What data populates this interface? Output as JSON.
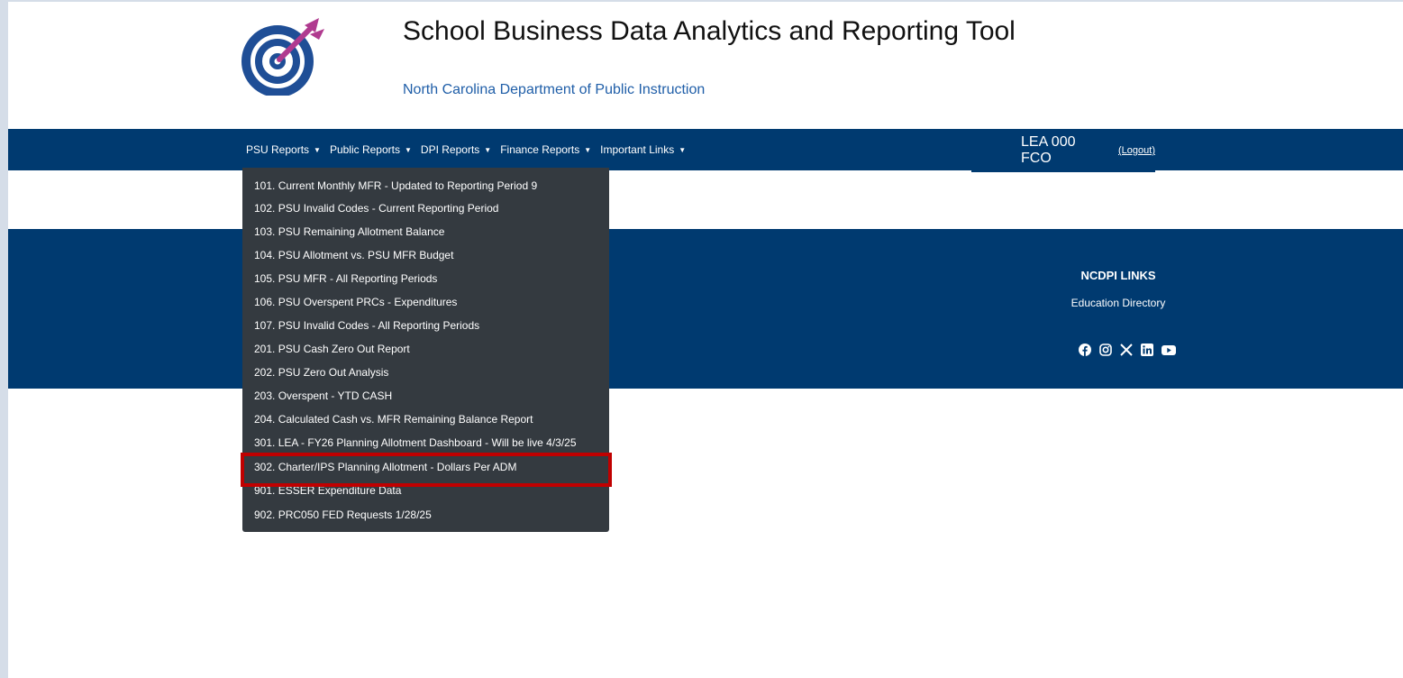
{
  "header": {
    "title": "School Business Data Analytics and Reporting Tool",
    "subtitle": "North Carolina Department of Public Instruction",
    "logo_icon": "target-dart-icon"
  },
  "nav": {
    "items": [
      {
        "label": "PSU Reports"
      },
      {
        "label": "Public Reports"
      },
      {
        "label": "DPI Reports"
      },
      {
        "label": "Finance Reports"
      },
      {
        "label": "Important Links"
      }
    ],
    "user": "LEA 000 FCO",
    "logout": "(Logout)"
  },
  "dropdown": {
    "items": [
      "101. Current Monthly MFR - Updated to Reporting Period 9",
      "102. PSU Invalid Codes - Current Reporting Period",
      "103. PSU Remaining Allotment Balance",
      "104. PSU Allotment vs. PSU MFR Budget",
      "105. PSU MFR - All Reporting Periods",
      "106. PSU Overspent PRCs - Expenditures",
      "107. PSU Invalid Codes - All Reporting Periods",
      "201. PSU Cash Zero Out Report",
      "202. PSU Zero Out Analysis",
      "203. Overspent - YTD CASH",
      "204. Calculated Cash vs. MFR Remaining Balance Report",
      "301. LEA - FY26 Planning Allotment Dashboard - Will be live 4/3/25",
      "302. Charter/IPS Planning Allotment - Dollars Per ADM",
      "901. ESSER Expenditure Data",
      "902. PRC050 FED Requests 1/28/25"
    ],
    "highlighted_index": 12
  },
  "footer": {
    "heading": "NCDPI LINKS",
    "link": "Education Directory",
    "social_icons": [
      "facebook-icon",
      "instagram-icon",
      "x-icon",
      "linkedin-icon",
      "youtube-icon"
    ]
  },
  "colors": {
    "navy": "#003a70",
    "dropdown_bg": "#343a40",
    "highlight": "#c00000",
    "subtitle": "#1f5ea8"
  }
}
